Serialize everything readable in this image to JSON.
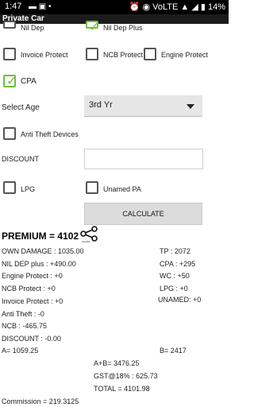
{
  "status": {
    "time": "1:47",
    "left_icons": "▬ ▣ •",
    "right_text": "⏰ ◉ VoLTE ▲ ◢ ▮ 14%"
  },
  "app": {
    "title": "Private Car"
  },
  "options": {
    "nil_dep": "Nil Dep",
    "nil_dep_plus": "Nil Dep Plus",
    "invoice_protect": "Invoice Protect",
    "ncb_protect": "NCB Protect",
    "engine_protect": "Engine Protect",
    "cpa": "CPA",
    "anti_theft": "Anti Theft Devices",
    "lpg": "LPG",
    "unnamed_pa": "Unamed PA"
  },
  "form": {
    "select_age_label": "Select Age",
    "select_age_value": "3rd Yr",
    "discount_label": "DISCOUNT",
    "discount_value": "",
    "calculate": "CALCULATE"
  },
  "result": {
    "premium": "PREMIUM = 4102",
    "share_caption": "SHARE",
    "own_damage": "OWN DAMAGE : 1035.00",
    "tp": "TP : 2072",
    "nil_dep_plus": "NIL DEP plus : +490.00",
    "cpa": "CPA : +295",
    "engine_protect": "Engine Protect : +0",
    "wc": "WC : +50",
    "ncb_protect": "NCB Protect : +0",
    "lpg": "LPG : +0",
    "invoice_protect": "Invoice Protect : +0",
    "unamed": "UNAMED: +0",
    "anti_theft": "Anti Theft : -0",
    "ncb": "NCB : -465.75",
    "discount": "DISCOUNT : -0.00",
    "a": "A= 1059.25",
    "b": "B= 2417",
    "ab": "A+B= 3476.25",
    "gst": "GST@18% : 625.73",
    "total": "TOTAL =  4101.98",
    "commission": "Commission = 219.3125"
  }
}
